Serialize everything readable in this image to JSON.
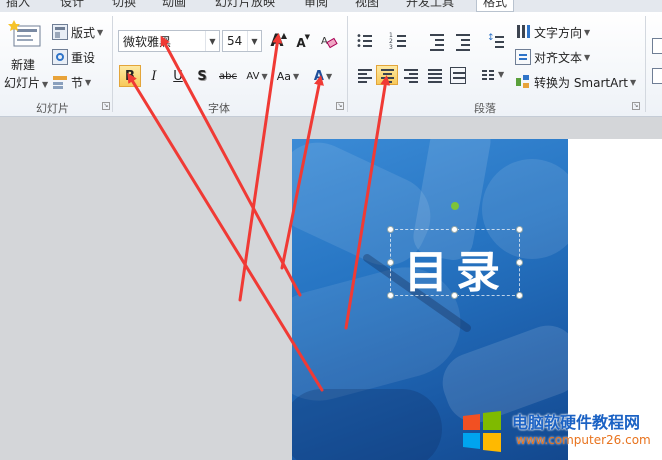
{
  "tabs": [
    "插入",
    "设计",
    "切换",
    "动画",
    "幻灯片放映",
    "审阅",
    "视图",
    "开发工具",
    "格式"
  ],
  "active_tab": "格式",
  "slides_group": {
    "label": "幻灯片",
    "new_slide_line1": "新建",
    "new_slide_line2": "幻灯片",
    "layout": "版式",
    "reset": "重设",
    "section": "节"
  },
  "font_group": {
    "label": "字体",
    "font_name": "微软雅黑",
    "font_size": "54",
    "bold": "B",
    "italic": "I",
    "underline": "U",
    "shadow": "S",
    "strike": "abc",
    "spacing": "AV",
    "change_case": "Aa",
    "font_color": "A",
    "grow": "A",
    "shrink": "A"
  },
  "paragraph_group": {
    "label": "段落",
    "text_direction": "文字方向",
    "align_text": "对齐文本",
    "convert_smartart": "转换为 SmartArt"
  },
  "slide": {
    "title": "目录"
  },
  "watermark": {
    "title": "电脑软硬件教程网",
    "url": "www.computer26.com"
  },
  "colors": {
    "slide_blue": "#2674c2",
    "arrow_red": "#f03a35",
    "active_highlight": "#f7c95a",
    "rotate_handle": "#7ec33b"
  }
}
